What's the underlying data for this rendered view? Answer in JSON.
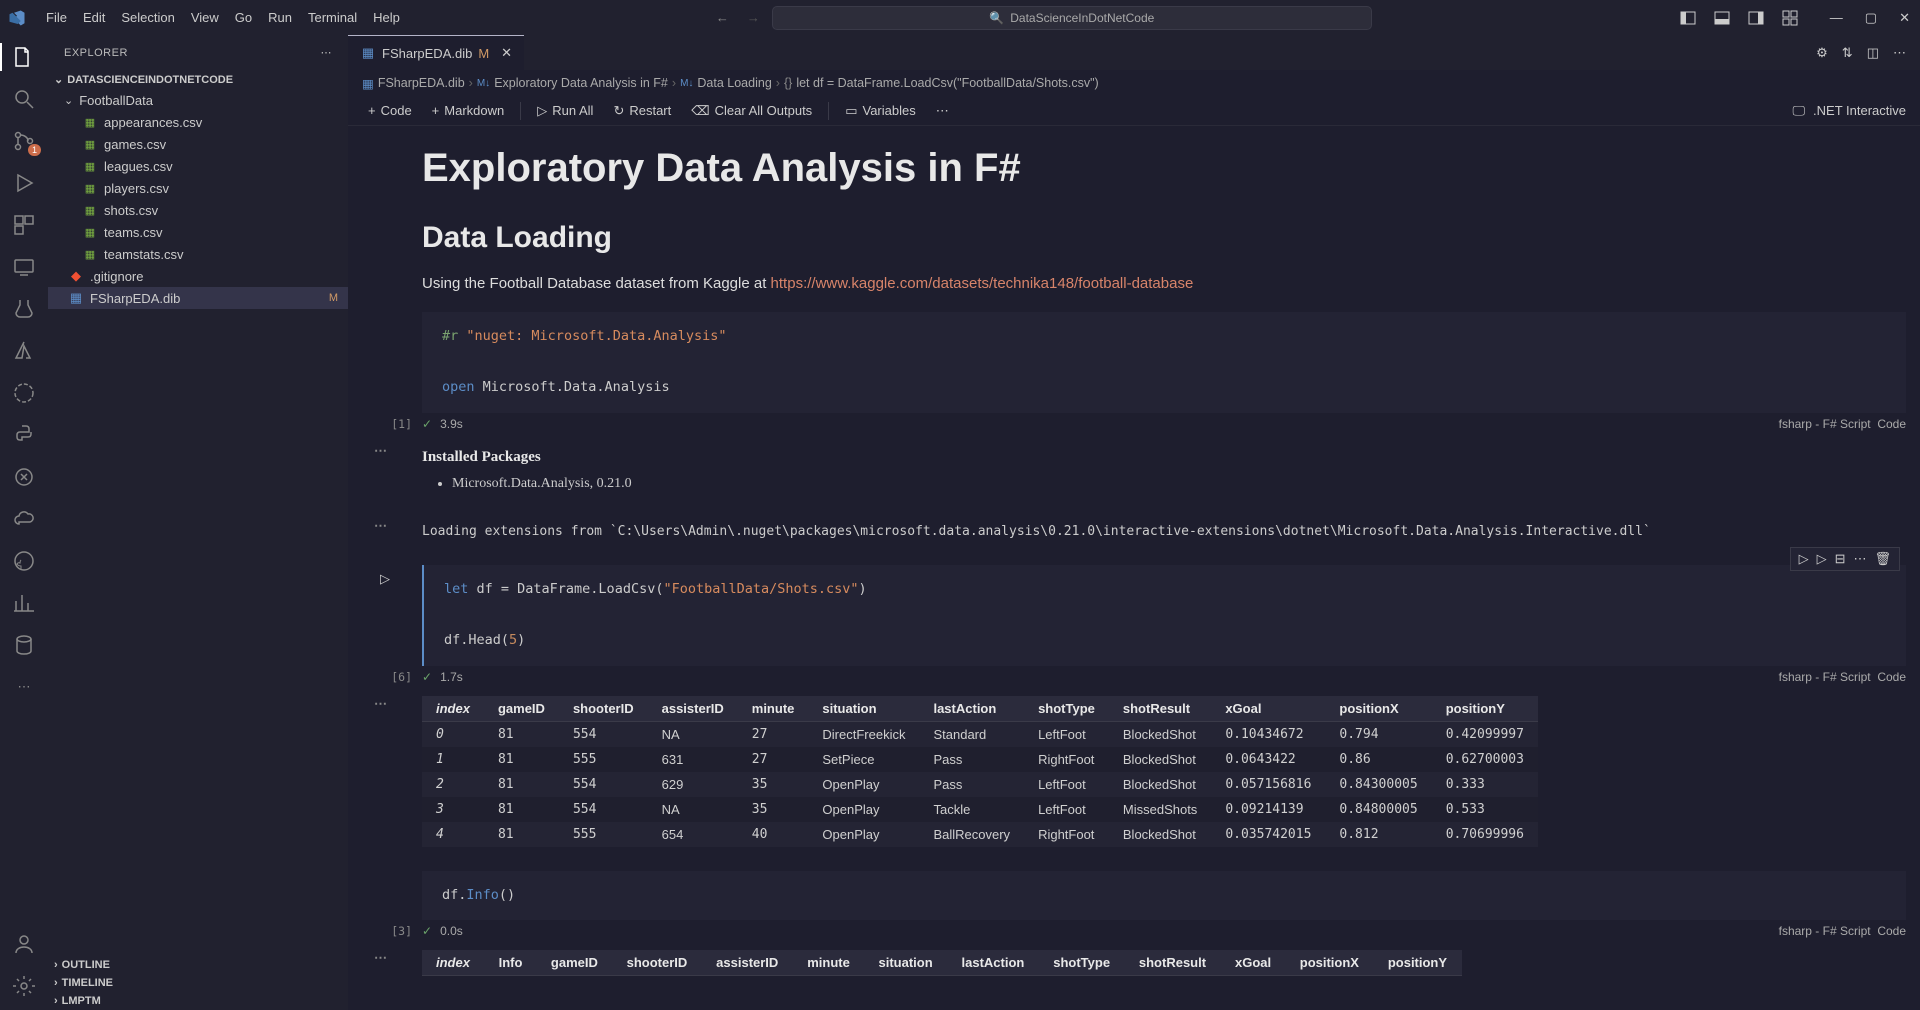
{
  "menu": [
    "File",
    "Edit",
    "Selection",
    "View",
    "Go",
    "Run",
    "Terminal",
    "Help"
  ],
  "titleSearch": "DataScienceInDotNetCode",
  "sidebar": {
    "title": "EXPLORER",
    "project": "DATASCIENCEINDOTNETCODE",
    "folder": "FootballData",
    "files": [
      "appearances.csv",
      "games.csv",
      "leagues.csv",
      "players.csv",
      "shots.csv",
      "teams.csv",
      "teamstats.csv"
    ],
    "gitignore": ".gitignore",
    "notebook": "FSharpEDA.dib",
    "notebookBadge": "M",
    "bottom": [
      "OUTLINE",
      "TIMELINE",
      "LMPTM"
    ]
  },
  "tab": {
    "name": "FSharpEDA.dib",
    "mod": "M"
  },
  "breadcrumb": {
    "file": "FSharpEDA.dib",
    "h1": "Exploratory Data Analysis in F#",
    "h2": "Data Loading",
    "code": "let df = DataFrame.LoadCsv(\"FootballData/Shots.csv\")"
  },
  "nbToolbar": {
    "code": "Code",
    "markdown": "Markdown",
    "runAll": "Run All",
    "restart": "Restart",
    "clear": "Clear All Outputs",
    "vars": "Variables",
    "kernel": ".NET Interactive"
  },
  "md": {
    "h1": "Exploratory Data Analysis in F#",
    "h2": "Data Loading",
    "intro": "Using the Football Database dataset from Kaggle at ",
    "link": "https://www.kaggle.com/datasets/technika148/football-database"
  },
  "cell1": {
    "idx": "[1]",
    "time": "3.9s",
    "lang": "fsharp - F# Script",
    "kind": "Code",
    "pkgHeader": "Installed Packages",
    "pkg": "Microsoft.Data.Analysis, 0.21.0",
    "ext": "Loading extensions from `C:\\Users\\Admin\\.nuget\\packages\\microsoft.data.analysis\\0.21.0\\interactive-extensions\\dotnet\\Microsoft.Data.Analysis.Interactive.dll`"
  },
  "cell2": {
    "idx": "[6]",
    "time": "1.7s",
    "lang": "fsharp - F# Script",
    "kind": "Code"
  },
  "cell3": {
    "idx": "[3]",
    "time": "0.0s",
    "lang": "fsharp - F# Script",
    "kind": "Code"
  },
  "chart_data": {
    "type": "table",
    "title": "df.Head(5)",
    "columns": [
      "index",
      "gameID",
      "shooterID",
      "assisterID",
      "minute",
      "situation",
      "lastAction",
      "shotType",
      "shotResult",
      "xGoal",
      "positionX",
      "positionY"
    ],
    "rows": [
      [
        "0",
        "81",
        "554",
        "NA",
        "27",
        "DirectFreekick",
        "Standard",
        "LeftFoot",
        "BlockedShot",
        "0.10434672",
        "0.794",
        "0.42099997"
      ],
      [
        "1",
        "81",
        "555",
        "631",
        "27",
        "SetPiece",
        "Pass",
        "RightFoot",
        "BlockedShot",
        "0.0643422",
        "0.86",
        "0.62700003"
      ],
      [
        "2",
        "81",
        "554",
        "629",
        "35",
        "OpenPlay",
        "Pass",
        "LeftFoot",
        "BlockedShot",
        "0.057156816",
        "0.84300005",
        "0.333"
      ],
      [
        "3",
        "81",
        "554",
        "NA",
        "35",
        "OpenPlay",
        "Tackle",
        "LeftFoot",
        "MissedShots",
        "0.09214139",
        "0.84800005",
        "0.533"
      ],
      [
        "4",
        "81",
        "555",
        "654",
        "40",
        "OpenPlay",
        "BallRecovery",
        "RightFoot",
        "BlockedShot",
        "0.035742015",
        "0.812",
        "0.70699996"
      ]
    ]
  },
  "infoTable": {
    "columns": [
      "index",
      "Info",
      "gameID",
      "shooterID",
      "assisterID",
      "minute",
      "situation",
      "lastAction",
      "shotType",
      "shotResult",
      "xGoal",
      "positionX",
      "positionY"
    ]
  },
  "scmBadge": "1"
}
